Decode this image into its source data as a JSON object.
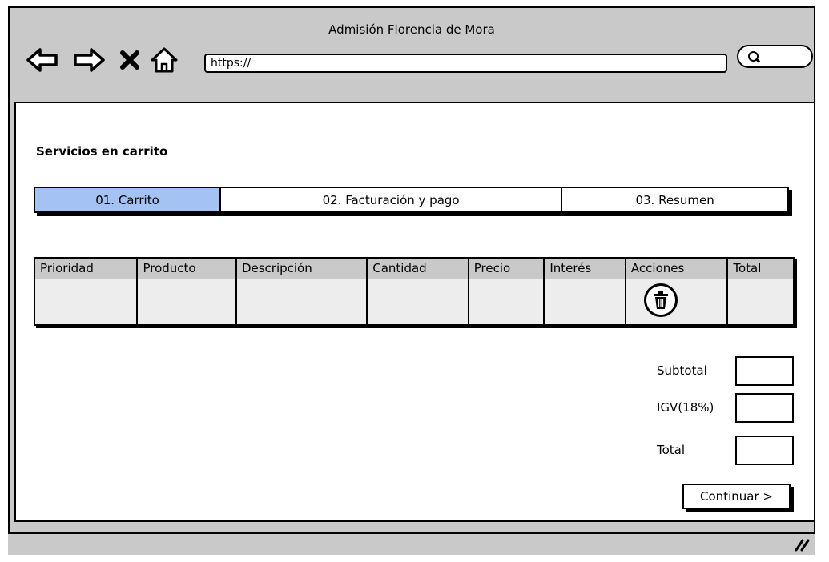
{
  "window": {
    "title": "Admisión  Florencia de Mora"
  },
  "toolbar": {
    "url": "https://"
  },
  "page": {
    "title": "Servicios en carrito"
  },
  "steps": [
    {
      "label": "01. Carrito",
      "active": true
    },
    {
      "label": "02. Facturación y pago",
      "active": false
    },
    {
      "label": "03. Resumen",
      "active": false
    }
  ],
  "table": {
    "headers": [
      "Prioridad",
      "Producto",
      "Descripción",
      "Cantidad",
      "Precio",
      "Interés",
      "Acciones",
      "Total"
    ]
  },
  "totals": {
    "subtotal_label": "Subtotal",
    "igv_label": "IGV(18%)",
    "total_label": "Total"
  },
  "actions": {
    "continue_label": "Continuar >"
  },
  "icons": {
    "back": "arrow-left-icon",
    "forward": "arrow-right-icon",
    "stop": "close-icon",
    "home": "home-icon",
    "search": "search-icon",
    "delete": "trash-icon",
    "resize": "resize-grip-icon"
  },
  "colors": {
    "active_step": "#a4c2f4",
    "chrome": "#c9c9c9",
    "table_body": "#ededed"
  }
}
